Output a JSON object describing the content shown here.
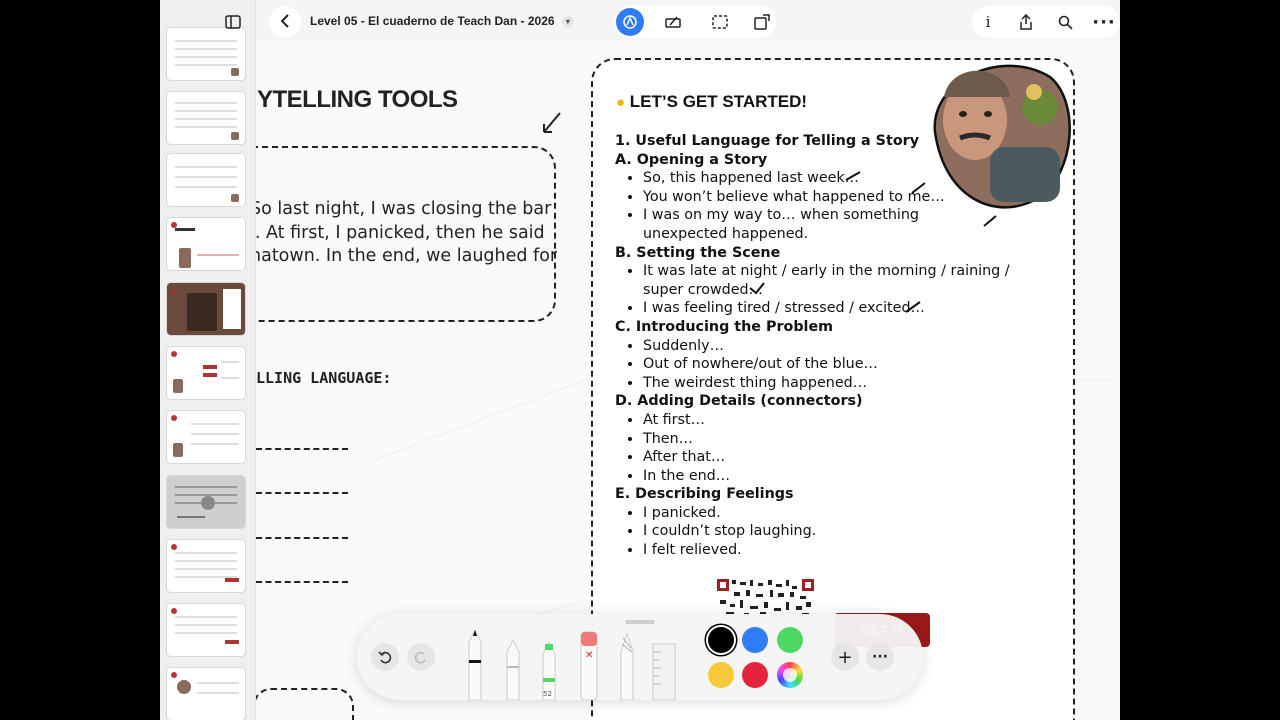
{
  "doc": {
    "title": "Level 05 - El cuaderno de Teach Dan - 2026"
  },
  "left_page": {
    "heading": "YTELLING TOOLS",
    "story_lines": [
      "So last night, I was closing the bar",
      "l. At first, I panicked, then he said",
      "natown. In the end, we laughed for"
    ],
    "section_label": "LLING LANGUAGE:"
  },
  "right_page": {
    "title_icon": "lightbulb-icon",
    "title": "LET’S GET STARTED!",
    "subtitle": "1. Useful Language for Telling a Story",
    "sections": [
      {
        "heading": "A. Opening a Story",
        "items": [
          "So, this happened last week…",
          "You won’t believe what happened to me…",
          "I was on my way to… when something unexpected happened."
        ]
      },
      {
        "heading": "B. Setting the Scene",
        "items": [
          "It was late at night / early in the morning / raining / super crowded…",
          "I was feeling tired / stressed / excited…"
        ]
      },
      {
        "heading": "C. Introducing the Problem",
        "items": [
          "Suddenly…",
          "Out of nowhere/out of the blue…",
          "The weirdest thing happened…"
        ]
      },
      {
        "heading": "D. Adding Details (connectors)",
        "items": [
          "At first…",
          "Then…",
          "After that…",
          "In the end…"
        ]
      },
      {
        "heading": "E. Describing Feelings",
        "items": [
          "I panicked.",
          "I couldn’t stop laughing.",
          "I felt relieved."
        ]
      }
    ],
    "cta_button": "GET IT"
  },
  "toolbar": {
    "pencil_size": "52",
    "colors": [
      "#000000",
      "#2f7cf6",
      "#4cd964",
      "#f5c93a",
      "#e5243b",
      "rainbow"
    ],
    "selected_color": "#000000"
  },
  "icons": {
    "sidebar_toggle": "sidebar-icon",
    "back": "chevron-left-icon",
    "title_dropdown": "chevron-down-icon",
    "pen_mode": "pen-nib-icon",
    "highlighter_mode": "marker-icon",
    "select_mode": "dashed-rect-icon",
    "shapes_mode": "shape-icon",
    "info": "info-icon",
    "share": "share-icon",
    "search": "search-icon",
    "more": "ellipsis-icon",
    "undo": "undo-icon",
    "redo": "redo-icon",
    "add": "plus-icon"
  }
}
